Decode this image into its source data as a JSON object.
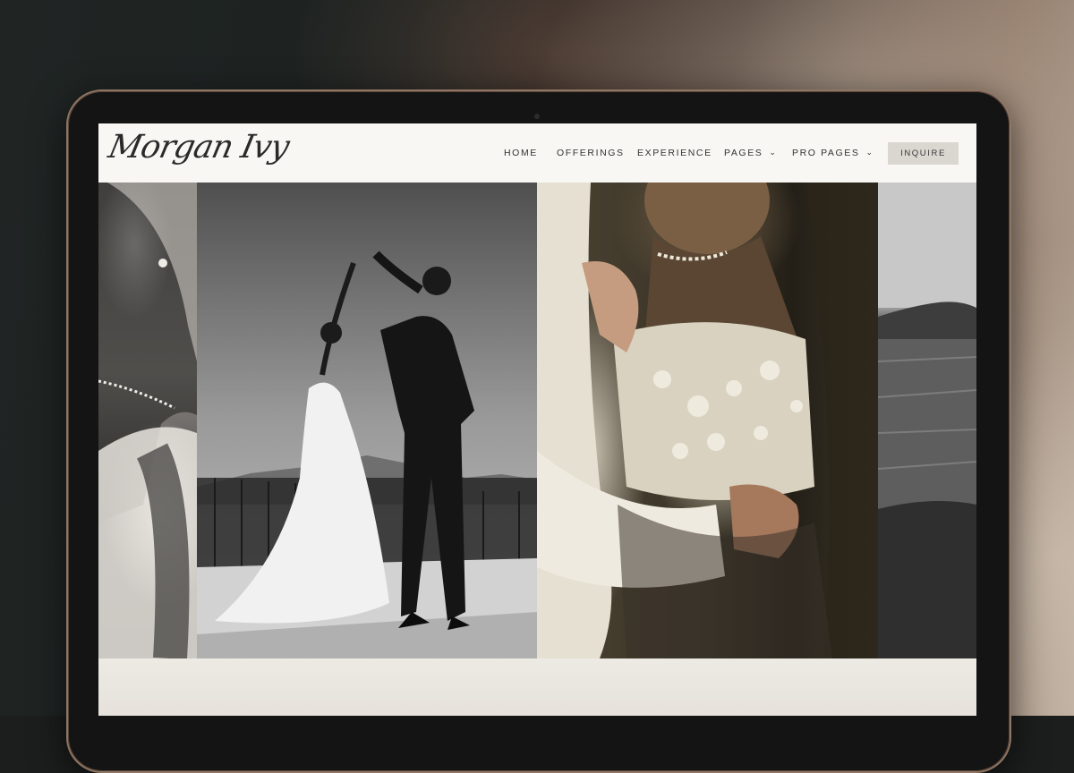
{
  "site": {
    "logo_text": "Morgan Ivy"
  },
  "nav": {
    "items": [
      {
        "label": "HOME",
        "has_dropdown": false
      },
      {
        "label": "OFFERINGS",
        "has_dropdown": false
      },
      {
        "label": "EXPERIENCE",
        "has_dropdown": false
      },
      {
        "label": "PAGES",
        "has_dropdown": true
      },
      {
        "label": "PRO PAGES",
        "has_dropdown": true
      }
    ],
    "cta_label": "INQUIRE"
  },
  "icons": {
    "dropdown": "chevron-down-icon"
  },
  "colors": {
    "nav_bg": "#f8f7f4",
    "cta_bg": "#dad6d0",
    "laptop_frame": "#141414",
    "laptop_edge": "#8f7563"
  }
}
